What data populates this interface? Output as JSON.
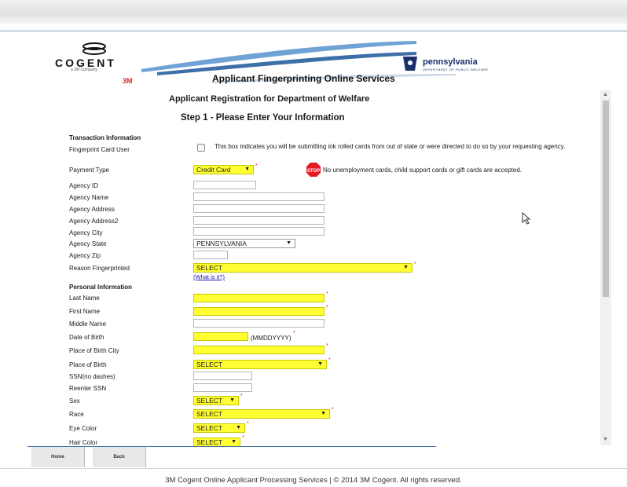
{
  "header": {
    "brand_name": "COGENT",
    "brand_sub": "a 3M Company",
    "brand_3m": "3M",
    "state_name": "pennsylvania",
    "state_sub": "DEPARTMENT OF PUBLIC WELFARE",
    "title": "Applicant Fingerprinting Online Services"
  },
  "page": {
    "title": "Applicant Registration for Department of Welfare",
    "step": "Step 1 - Please Enter Your Information"
  },
  "form": {
    "transaction_header": "Transaction Information",
    "card_user_label": "Fingerprint Card User",
    "card_user_note": "This box indicates you will be submitting ink rolled cards from out of state or were directed to do so by your requesting agency.",
    "payment_label": "Payment Type",
    "payment_value": "Credit Card",
    "payment_note": "No unemployment cards, child support cards or gift cards are accepted.",
    "stop_text": "STOP",
    "agency_id_label": "Agency ID",
    "agency_name_label": "Agency Name",
    "agency_address_label": "Agency Address",
    "agency_address2_label": "Agency Address2",
    "agency_city_label": "Agency City",
    "agency_state_label": "Agency State",
    "agency_state_value": "PENNSYLVANIA",
    "agency_zip_label": "Agency Zip",
    "reason_label": "Reason Fingerprinted",
    "reason_value": "SELECT",
    "what_is_it": "(What is it?)",
    "personal_header": "Personal Information",
    "last_name_label": "Last Name",
    "first_name_label": "First Name",
    "middle_name_label": "Middle Name",
    "dob_label": "Date of Birth",
    "dob_hint": "(MMDDYYYY)",
    "pob_city_label": "Place of Birth City",
    "pob_label": "Place of Birth",
    "pob_value": "SELECT",
    "ssn_label": "SSN(no dashes)",
    "ssn2_label": "Reenter SSN",
    "sex_label": "Sex",
    "sex_value": "SELECT",
    "race_label": "Race",
    "race_value": "SELECT",
    "eye_label": "Eye Color",
    "eye_value": "SELECT",
    "hair_label": "Hair Color",
    "hair_value": "SELECT"
  },
  "nav": {
    "home": "Home",
    "back": "Back"
  },
  "footer": {
    "copyright": "3M Cogent Online Applicant Processing Services | © 2014 3M Cogent. All rights reserved."
  },
  "colors": {
    "required": "#ffff33",
    "accent_red": "#e31b23",
    "nav_blue": "#1a2f6b"
  }
}
